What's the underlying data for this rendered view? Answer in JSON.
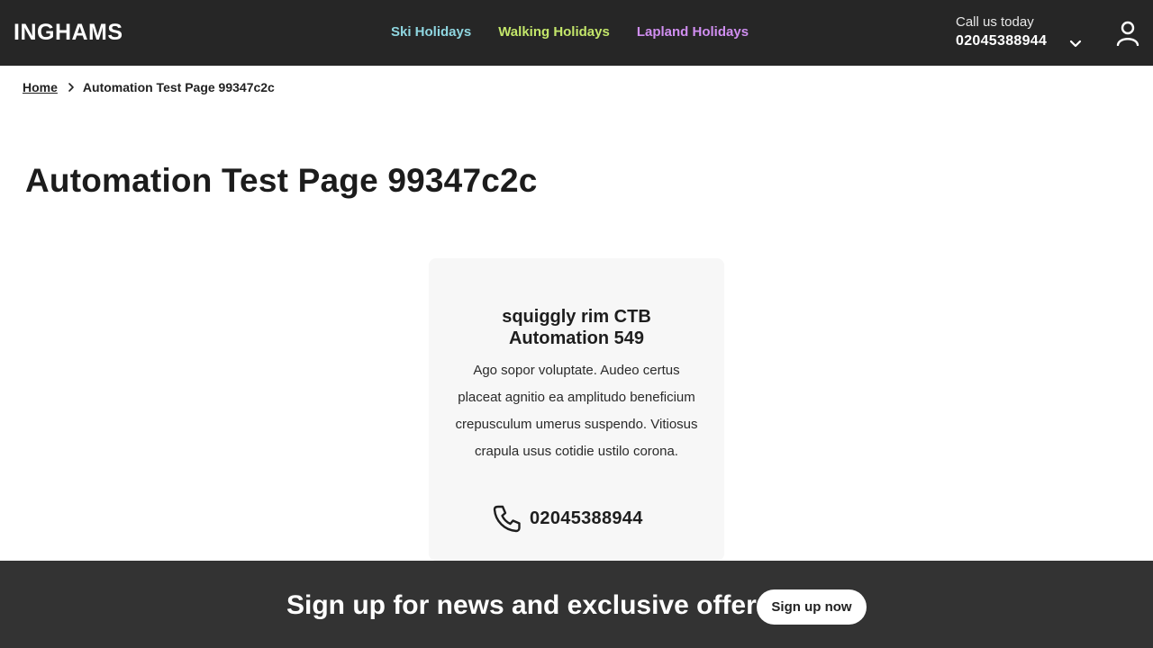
{
  "header": {
    "logo": "INGHAMS",
    "nav": [
      {
        "label": "Ski Holidays",
        "color": "#8fd6e0"
      },
      {
        "label": "Walking Holidays",
        "color": "#c3e66a"
      },
      {
        "label": "Lapland Holidays",
        "color": "#d08ef0"
      }
    ],
    "call_label": "Call us today",
    "call_number": "02045388944",
    "icons": {
      "call_toggle": "chevron-down-icon",
      "account": "user-icon"
    }
  },
  "breadcrumb": {
    "home": "Home",
    "current": "Automation Test Page 99347c2c",
    "separator_icon": "chevron-right-icon"
  },
  "page": {
    "title": "Automation Test Page 99347c2c"
  },
  "card": {
    "title": "squiggly rim CTB Automation 549",
    "text": "Ago sopor voluptate. Audeo certus placeat agnitio ea amplitudo beneficium crepusculum umerus suspendo. Vitiosus crapula usus cotidie ustilo corona.",
    "phone_icon": "phone-icon",
    "phone": "02045388944"
  },
  "banner": {
    "text": "Sign up for news and exclusive offers",
    "button": "Sign up now"
  },
  "colors": {
    "header_bg": "#262626",
    "banner_bg": "#333333",
    "card_bg": "#f7f7f7"
  }
}
